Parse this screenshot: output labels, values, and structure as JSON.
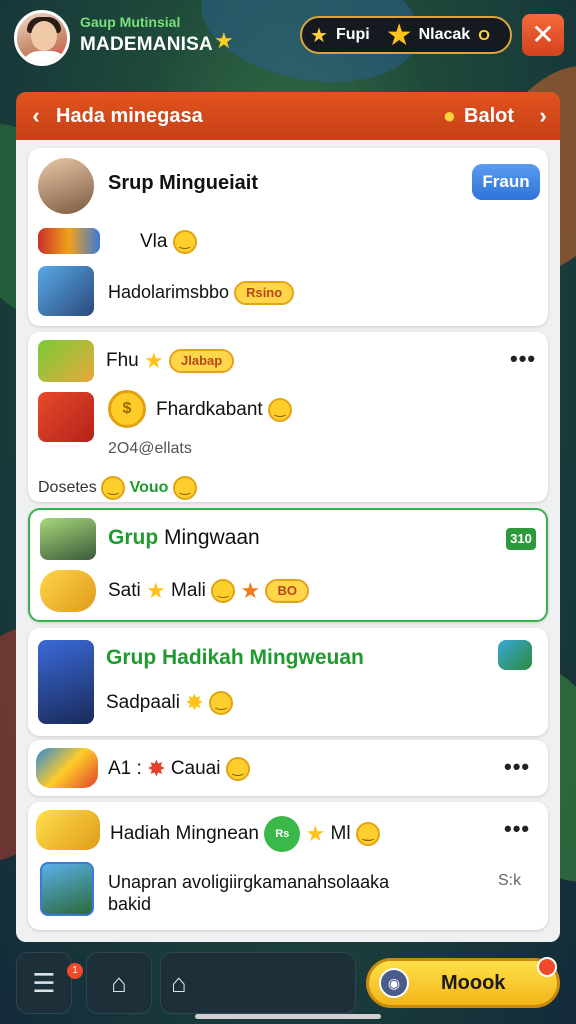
{
  "header": {
    "user_subtitle": "Gaup Mutinsial",
    "user_name": "MADEMANISA",
    "currency_a": "Fupi",
    "currency_b": "Nlacak",
    "currency_b_suffix": "O"
  },
  "panel": {
    "title": "Hada minegasa",
    "action_label": "Balot"
  },
  "cards": {
    "c1": {
      "title": "Srup Mingueiait",
      "button": "Fraun",
      "row2": "Vla",
      "row3": "Hadolarimsbbo",
      "row3_pill": "Rsino"
    },
    "c2": {
      "row1": "Fhu",
      "row1_pill": "Jlabap",
      "row2": "Fhardkabant",
      "row3": "2O4@ellats",
      "row4_a": "Dosetes",
      "row4_b": "Vouo"
    },
    "c3": {
      "title_a": "Grup",
      "title_b": "Mingwaan",
      "badge": "310",
      "row2_a": "Sati",
      "row2_b": "Mali",
      "row2_pill": "BO"
    },
    "c4": {
      "title": "Grup Hadikah Mingweuan",
      "row2": "Sadpaali"
    },
    "c5": {
      "row1": "A1 :",
      "row1_b": "Cauai"
    },
    "c6": {
      "title": "Hadiah Mingnean",
      "title_tail": "Ml",
      "row2": "Unapran avoligiirgkamanahsolaaka",
      "row2_b": "bakid",
      "row2_count": "S:k"
    }
  },
  "bottom_nav": {
    "badge": "1",
    "main_label": "Moook"
  }
}
